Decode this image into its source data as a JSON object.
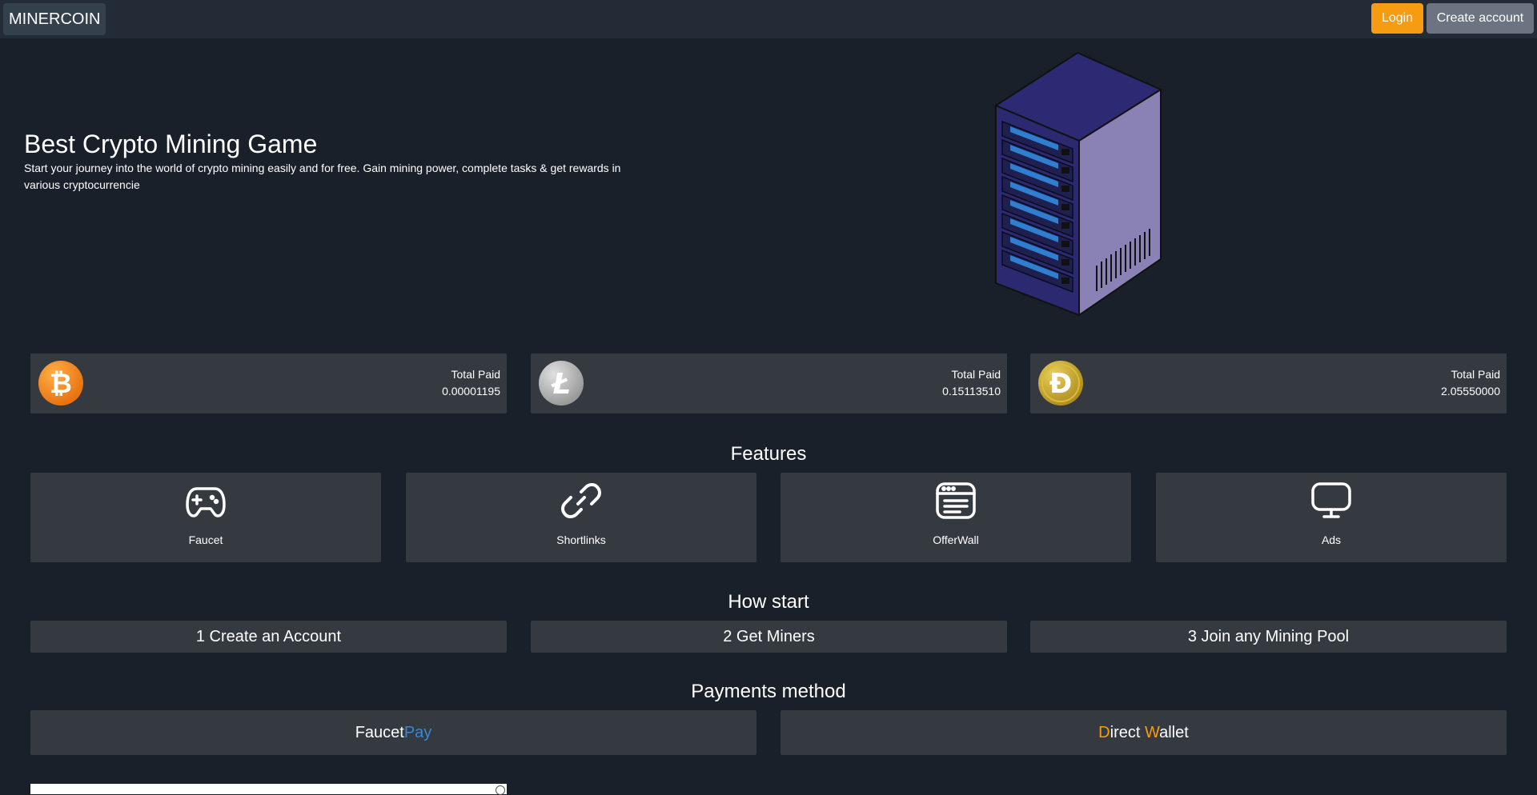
{
  "navbar": {
    "brand": "MINERCOIN",
    "login_label": "Login",
    "create_account_label": "Create account"
  },
  "hero": {
    "title": "Best Crypto Mining Game",
    "subtitle": "Start your journey into the world of crypto mining easily and for free. Gain mining power, complete tasks & get rewards in various cryptocurrencie"
  },
  "stats": [
    {
      "icon": "bitcoin-icon",
      "label": "Total Paid",
      "value": "0.00001195",
      "color": "#f7931a"
    },
    {
      "icon": "litecoin-icon",
      "label": "Total Paid",
      "value": "0.15113510",
      "color": "#bebebe"
    },
    {
      "icon": "dogecoin-icon",
      "label": "Total Paid",
      "value": "2.05550000",
      "color": "#c2a633"
    }
  ],
  "features": {
    "title": "Features",
    "items": [
      {
        "icon": "gamepad-icon",
        "label": "Faucet"
      },
      {
        "icon": "link-icon",
        "label": "Shortlinks"
      },
      {
        "icon": "browser-window-icon",
        "label": "OfferWall"
      },
      {
        "icon": "monitor-icon",
        "label": "Ads"
      }
    ]
  },
  "how_start": {
    "title": "How start",
    "steps": [
      {
        "label": "1 Create an Account"
      },
      {
        "label": "2 Get Miners"
      },
      {
        "label": "3 Join any Mining Pool"
      }
    ]
  },
  "payments": {
    "title": "Payments method",
    "faucetpay": {
      "part1": "Faucet",
      "part2": "Pay"
    },
    "direct_wallet": {
      "d": "D",
      "irect": "irect ",
      "w": "W",
      "allet": "allet"
    }
  },
  "colors": {
    "background": "#1a202a",
    "navbar": "#232b36",
    "card": "#343a40",
    "accent_orange": "#f59c12",
    "accent_blue": "#3a87d6"
  }
}
